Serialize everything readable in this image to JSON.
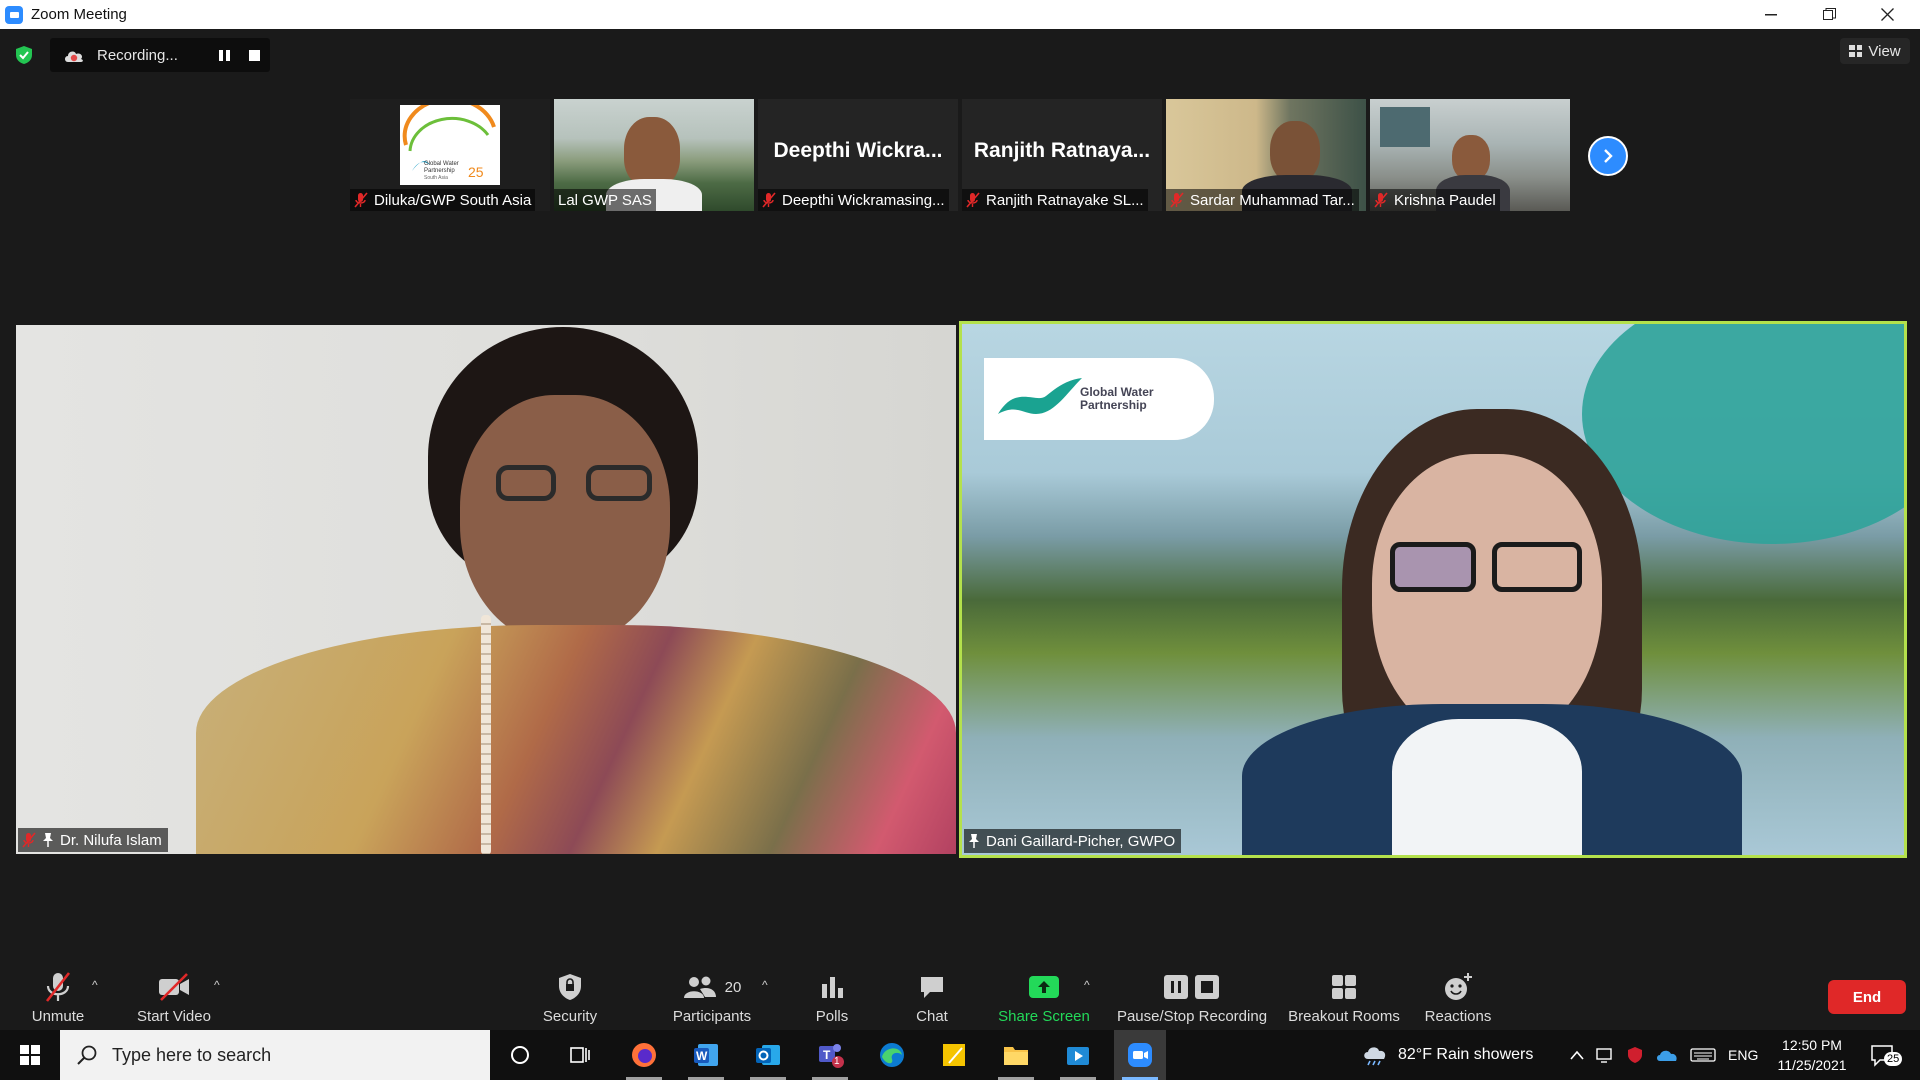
{
  "window": {
    "title": "Zoom Meeting"
  },
  "recording": {
    "label": "Recording..."
  },
  "view": {
    "label": "View"
  },
  "filmstrip": [
    {
      "name": "Diluka/GWP South Asia",
      "logo_text": "Global Water Partnership",
      "logo_sub": "South Asia",
      "logo_badge": "25"
    },
    {
      "name": "Lal GWP SAS"
    },
    {
      "name": "Deepthi Wickramasing...",
      "display": "Deepthi  Wickra..."
    },
    {
      "name": "Ranjith Ratnayake  SL...",
      "display": "Ranjith  Ratnaya..."
    },
    {
      "name": "Sardar Muhammad Tar..."
    },
    {
      "name": "Krishna Paudel"
    }
  ],
  "main": {
    "left": {
      "name": "Dr. Nilufa Islam"
    },
    "right": {
      "name": "Dani Gaillard-Picher, GWPO",
      "logo_text": "Global Water",
      "logo_text2": "Partnership"
    }
  },
  "toolbar": {
    "unmute": "Unmute",
    "start_video": "Start Video",
    "security": "Security",
    "participants": "Participants",
    "participants_count": "20",
    "polls": "Polls",
    "chat": "Chat",
    "share_screen": "Share Screen",
    "pause_stop": "Pause/Stop Recording",
    "breakout": "Breakout Rooms",
    "reactions": "Reactions",
    "end": "End"
  },
  "taskbar": {
    "search_placeholder": "Type here to search",
    "weather": "82°F  Rain showers",
    "lang": "ENG",
    "time": "12:50 PM",
    "date": "11/25/2021",
    "notifications": "25",
    "teams_badge": "1"
  },
  "colors": {
    "accent": "#2d8cff",
    "active_speaker": "#b4e14c",
    "share_green": "#23d959",
    "end_red": "#e02828"
  }
}
